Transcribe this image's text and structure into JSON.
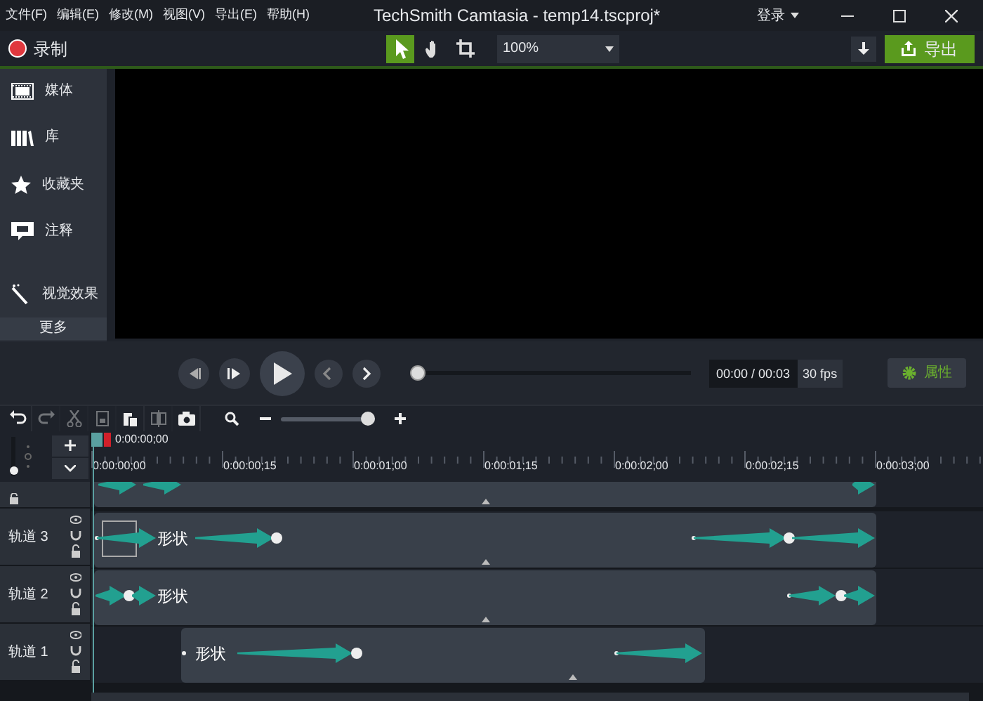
{
  "window": {
    "title": "TechSmith Camtasia - temp14.tscproj*"
  },
  "menu": [
    "文件(F)",
    "编辑(E)",
    "修改(M)",
    "视图(V)",
    "导出(E)",
    "帮助(H)"
  ],
  "account": {
    "label": "登录"
  },
  "toolbar": {
    "record": "录制",
    "tools": [
      {
        "kind": "pointer",
        "selected": true
      },
      {
        "kind": "hand",
        "selected": false
      },
      {
        "kind": "crop",
        "selected": false
      }
    ],
    "zoom": "100%",
    "export": "导出"
  },
  "sidebar": {
    "items": [
      {
        "kind": "media",
        "label": "媒体"
      },
      {
        "kind": "library",
        "label": "库"
      },
      {
        "kind": "favorites",
        "label": "收藏夹"
      },
      {
        "kind": "annotations",
        "label": "注释"
      },
      {
        "kind": "effects",
        "label": "视觉效果"
      }
    ],
    "more": "更多"
  },
  "player": {
    "progress": {
      "level": 0
    },
    "time": "00:00 / 00:03",
    "fps": "30 fps",
    "properties": "属性"
  },
  "timeline": {
    "tools": [
      {
        "kind": "undo",
        "disabled": false
      },
      {
        "kind": "redo",
        "disabled": true
      },
      {
        "kind": "cut",
        "disabled": true
      },
      {
        "kind": "copy",
        "disabled": true
      },
      {
        "kind": "paste",
        "disabled": false
      },
      {
        "kind": "split",
        "disabled": true
      },
      {
        "kind": "snapshot",
        "disabled": false
      }
    ],
    "zoom": {
      "level": 0.95
    },
    "track_height": {
      "level": 0.05
    },
    "playhead": "0:00:00;00",
    "ruler": [
      "0:00:00;00",
      "0:00:00;15",
      "0:00:01;00",
      "0:00:01;15",
      "0:00:02;00",
      "0:00:02;15",
      "0:00:03;00"
    ],
    "tracks": [
      {
        "cut_off": true
      },
      {
        "cut_off": false,
        "label": "轨道 3",
        "clip": "形状"
      },
      {
        "cut_off": false,
        "label": "轨道 2",
        "clip": "形状"
      },
      {
        "cut_off": false,
        "label": "轨道 1",
        "clip": "形状"
      }
    ]
  }
}
